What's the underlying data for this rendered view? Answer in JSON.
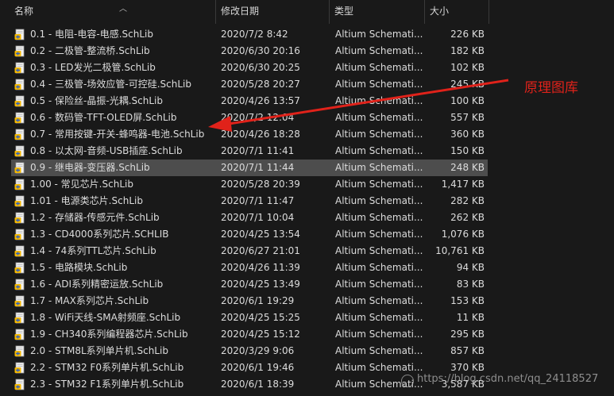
{
  "columns": {
    "name": "名称",
    "date": "修改日期",
    "type": "类型",
    "size": "大小"
  },
  "annotation": {
    "label": "原理图库",
    "color": "#e0221a"
  },
  "watermark": "https://blog.csdn.net/qq_24118527",
  "selected_index": 8,
  "files": [
    {
      "name": "0.1 - 电阻-电容-电感.SchLib",
      "date": "2020/7/2 8:42",
      "type": "Altium Schemati...",
      "size": "226 KB"
    },
    {
      "name": "0.2 - 二极管-整流桥.SchLib",
      "date": "2020/6/30 20:16",
      "type": "Altium Schemati...",
      "size": "182 KB"
    },
    {
      "name": "0.3 - LED发光二极管.SchLib",
      "date": "2020/6/30 20:25",
      "type": "Altium Schemati...",
      "size": "102 KB"
    },
    {
      "name": "0.4 - 三极管-场效应管-可控硅.SchLib",
      "date": "2020/5/28 20:27",
      "type": "Altium Schemati...",
      "size": "245 KB"
    },
    {
      "name": "0.5 - 保险丝-晶振-光耦.SchLib",
      "date": "2020/4/26 13:57",
      "type": "Altium Schemati...",
      "size": "100 KB"
    },
    {
      "name": "0.6 - 数码管-TFT-OLED屏.SchLib",
      "date": "2020/7/2 12:04",
      "type": "Altium Schemati...",
      "size": "557 KB"
    },
    {
      "name": "0.7 - 常用按键-开关-蜂鸣器-电池.SchLib",
      "date": "2020/4/26 18:28",
      "type": "Altium Schemati...",
      "size": "360 KB"
    },
    {
      "name": "0.8 - 以太网-音频-USB插座.SchLib",
      "date": "2020/7/1 11:41",
      "type": "Altium Schemati...",
      "size": "150 KB"
    },
    {
      "name": "0.9 - 继电器-变压器.SchLib",
      "date": "2020/7/1 11:44",
      "type": "Altium Schemati...",
      "size": "248 KB"
    },
    {
      "name": "1.00 - 常见芯片.SchLib",
      "date": "2020/5/28 20:39",
      "type": "Altium Schemati...",
      "size": "1,417 KB"
    },
    {
      "name": "1.01 - 电源类芯片.SchLib",
      "date": "2020/7/1 11:47",
      "type": "Altium Schemati...",
      "size": "282 KB"
    },
    {
      "name": "1.2 - 存储器-传感元件.SchLib",
      "date": "2020/7/1 10:04",
      "type": "Altium Schemati...",
      "size": "262 KB"
    },
    {
      "name": "1.3 - CD4000系列芯片.SCHLIB",
      "date": "2020/4/25 13:54",
      "type": "Altium Schemati...",
      "size": "1,076 KB"
    },
    {
      "name": "1.4 - 74系列TTL芯片.SchLib",
      "date": "2020/6/27 21:01",
      "type": "Altium Schemati...",
      "size": "10,761 KB"
    },
    {
      "name": "1.5 - 电路模块.SchLib",
      "date": "2020/4/26 11:39",
      "type": "Altium Schemati...",
      "size": "94 KB"
    },
    {
      "name": "1.6 - ADI系列精密运放.SchLib",
      "date": "2020/4/25 13:49",
      "type": "Altium Schemati...",
      "size": "83 KB"
    },
    {
      "name": "1.7 - MAX系列芯片.SchLib",
      "date": "2020/6/1 19:29",
      "type": "Altium Schemati...",
      "size": "153 KB"
    },
    {
      "name": "1.8 - WiFi天线-SMA射频座.SchLib",
      "date": "2020/4/25 15:25",
      "type": "Altium Schemati...",
      "size": "11 KB"
    },
    {
      "name": "1.9 - CH340系列编程器芯片.SchLib",
      "date": "2020/4/25 15:12",
      "type": "Altium Schemati...",
      "size": "295 KB"
    },
    {
      "name": "2.0 - STM8L系列单片机.SchLib",
      "date": "2020/3/29 9:06",
      "type": "Altium Schemati...",
      "size": "857 KB"
    },
    {
      "name": "2.2 - STM32 F0系列单片机.SchLib",
      "date": "2020/6/1 19:46",
      "type": "Altium Schemati...",
      "size": "370 KB"
    },
    {
      "name": "2.3 - STM32 F1系列单片机.SchLib",
      "date": "2020/6/1 18:39",
      "type": "Altium Schemati...",
      "size": "3,587 KB"
    }
  ]
}
